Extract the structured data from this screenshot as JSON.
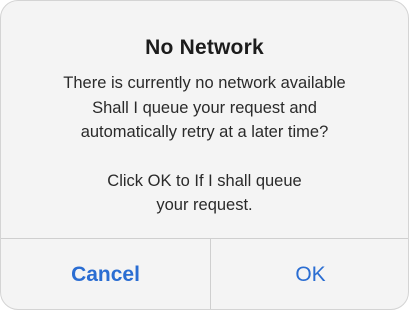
{
  "alert": {
    "title": "No Network",
    "message_lines": [
      "There is currently no network available",
      "Shall I queue your request and",
      "automatically retry at a later time?"
    ],
    "detail_lines": [
      "Click OK to If I shall queue",
      "your request."
    ],
    "buttons": {
      "cancel_label": "Cancel",
      "ok_label": "OK"
    }
  },
  "colors": {
    "background": "#f4f4f4",
    "title": "#1c1c1c",
    "text": "#2a2a2a",
    "accent": "#2a6dd2",
    "separator": "#cfcfcf"
  }
}
